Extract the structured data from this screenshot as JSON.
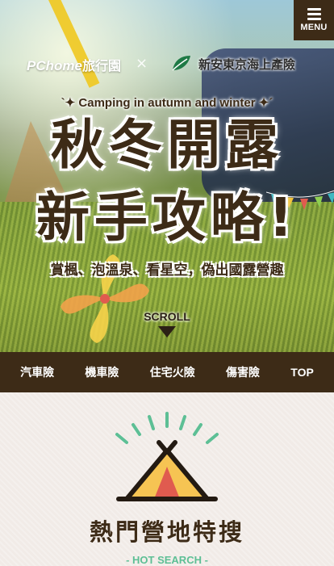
{
  "menu": {
    "label": "MENU"
  },
  "brand": {
    "pchome_label": "PChome",
    "pchome_zh": "旅行園",
    "separator": "×",
    "insurer_name": "新安東京海上產險"
  },
  "hero": {
    "tagline": "Camping in autumn and winter",
    "title_line1": "秋冬開露",
    "title_line2": "新手攻略!",
    "subtitle": "賞楓、泡溫泉、看星空，偽出國露營趣",
    "scroll_label": "SCROLL"
  },
  "nav": {
    "items": [
      {
        "label": "汽車險"
      },
      {
        "label": "機車險"
      },
      {
        "label": "住宅火險"
      },
      {
        "label": "傷害險"
      },
      {
        "label": "TOP"
      }
    ]
  },
  "hot_search": {
    "title": "熱門營地特搜",
    "subtitle": "- HOT SEARCH -"
  },
  "colors": {
    "brand_brown": "#3d2b17",
    "accent_green": "#5dbf95",
    "tent_yellow": "#f6c453",
    "tent_red": "#e05b4f"
  }
}
